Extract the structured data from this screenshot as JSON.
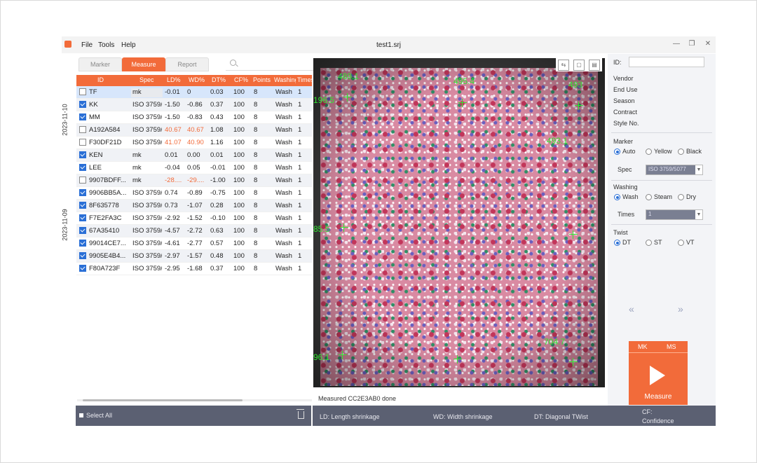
{
  "window": {
    "title": "test1.srj",
    "menu": [
      "File",
      "Tools",
      "Help"
    ],
    "controls": [
      "—",
      "❐",
      "✕"
    ]
  },
  "tabs": {
    "marker": "Marker",
    "measure": "Measure",
    "report": "Report",
    "clear": "×"
  },
  "dates": [
    "2023-11-10",
    "2023-11-09"
  ],
  "table": {
    "columns": [
      "ID",
      "Spec",
      "LD%",
      "WD%",
      "DT%",
      "CF%",
      "Points",
      "Washing",
      "Times"
    ],
    "rows": [
      {
        "checked": false,
        "id": "TF",
        "spec": "mk",
        "ld": "-0.01",
        "wd": "0",
        "dt": "0.03",
        "cf": "100",
        "points": "8",
        "washing": "Wash",
        "times": "1"
      },
      {
        "checked": true,
        "id": "KK",
        "spec": "ISO 3759/",
        "ld": "-1.50",
        "wd": "-0.86",
        "dt": "0.37",
        "cf": "100",
        "points": "8",
        "washing": "Wash",
        "times": "1"
      },
      {
        "checked": true,
        "id": "MM",
        "spec": "ISO 3759/",
        "ld": "-1.50",
        "wd": "-0.83",
        "dt": "0.43",
        "cf": "100",
        "points": "8",
        "washing": "Wash",
        "times": "1"
      },
      {
        "checked": false,
        "id": "A192A584",
        "spec": "ISO 3759/",
        "ld": "40.67",
        "wd": "40.67",
        "dt": "1.08",
        "cf": "100",
        "points": "8",
        "washing": "Wash",
        "times": "1"
      },
      {
        "checked": false,
        "id": "F30DF21D",
        "spec": "ISO 3759/",
        "ld": "41.07",
        "wd": "40.90",
        "dt": "1.16",
        "cf": "100",
        "points": "8",
        "washing": "Wash",
        "times": "1"
      },
      {
        "checked": true,
        "id": "KEN",
        "spec": "mk",
        "ld": "0.01",
        "wd": "0.00",
        "dt": "0.01",
        "cf": "100",
        "points": "8",
        "washing": "Wash",
        "times": "1"
      },
      {
        "checked": true,
        "id": "LEE",
        "spec": "mk",
        "ld": "-0.04",
        "wd": "0.05",
        "dt": "-0.01",
        "cf": "100",
        "points": "8",
        "washing": "Wash",
        "times": "1"
      },
      {
        "checked": false,
        "id": "9907BDFF...",
        "spec": "mk",
        "ld": "-28....",
        "wd": "-29....",
        "dt": "-1.00",
        "cf": "100",
        "points": "8",
        "washing": "Wash",
        "times": "1"
      },
      {
        "checked": true,
        "id": "9906BB5A...",
        "spec": "ISO 3759/",
        "ld": "0.74",
        "wd": "-0.89",
        "dt": "-0.75",
        "cf": "100",
        "points": "8",
        "washing": "Wash",
        "times": "1"
      },
      {
        "checked": true,
        "id": "8F635778",
        "spec": "ISO 3759/",
        "ld": "0.73",
        "wd": "-1.07",
        "dt": "0.28",
        "cf": "100",
        "points": "8",
        "washing": "Wash",
        "times": "1"
      },
      {
        "checked": true,
        "id": "F7E2FA3C",
        "spec": "ISO 3759/",
        "ld": "-2.92",
        "wd": "-1.52",
        "dt": "-0.10",
        "cf": "100",
        "points": "8",
        "washing": "Wash",
        "times": "1"
      },
      {
        "checked": true,
        "id": "67A35410",
        "spec": "ISO 3759/",
        "ld": "-4.57",
        "wd": "-2.72",
        "dt": "0.63",
        "cf": "100",
        "points": "8",
        "washing": "Wash",
        "times": "1"
      },
      {
        "checked": true,
        "id": "99014CE7...",
        "spec": "ISO 3759/",
        "ld": "-4.61",
        "wd": "-2.77",
        "dt": "0.57",
        "cf": "100",
        "points": "8",
        "washing": "Wash",
        "times": "1"
      },
      {
        "checked": true,
        "id": "9905E4B4...",
        "spec": "ISO 3759/",
        "ld": "-2.97",
        "wd": "-1.57",
        "dt": "0.48",
        "cf": "100",
        "points": "8",
        "washing": "Wash",
        "times": "1"
      },
      {
        "checked": true,
        "id": "F80A723F",
        "spec": "ISO 3759/",
        "ld": "-2.95",
        "wd": "-1.68",
        "dt": "0.37",
        "cf": "100",
        "points": "8",
        "washing": "Wash",
        "times": "1"
      }
    ]
  },
  "image_labels": [
    "489.1",
    "495.4",
    "493",
    "196.5",
    "493.1",
    "85.5",
    "96.1",
    "704.7"
  ],
  "image_tools": [
    "⇆",
    "▢",
    "▤"
  ],
  "status": "Measured CC2E3AB0 done",
  "footer": {
    "select_all": "Select All",
    "ld": "LD: Length shrinkage",
    "wd": "WD: Width shrinkage",
    "dt": "DT: Diagonal TWist",
    "cf": "CF:",
    "cf2": "Confidence"
  },
  "side": {
    "id_label": "ID:",
    "fields": [
      "Vendor",
      "End Use",
      "Season",
      "Contract",
      "Style No."
    ],
    "marker_label": "Marker",
    "marker_options": [
      "Auto",
      "Yellow",
      "Black"
    ],
    "spec_label": "Spec",
    "spec_value": "ISO 3759/5077",
    "washing_label": "Washing",
    "washing_options": [
      "Wash",
      "Steam",
      "Dry"
    ],
    "times_label": "Times",
    "times_value": "1",
    "twist_label": "Twist",
    "twist_options": [
      "DT",
      "ST",
      "VT"
    ],
    "prev": "«",
    "next": "»",
    "mk": "MK",
    "ms": "MS",
    "measure": "Measure"
  },
  "colors": {
    "accent": "#f26b3a",
    "check": "#2a6fd6",
    "footer": "#5b6072",
    "marker_text": "#33e533"
  }
}
